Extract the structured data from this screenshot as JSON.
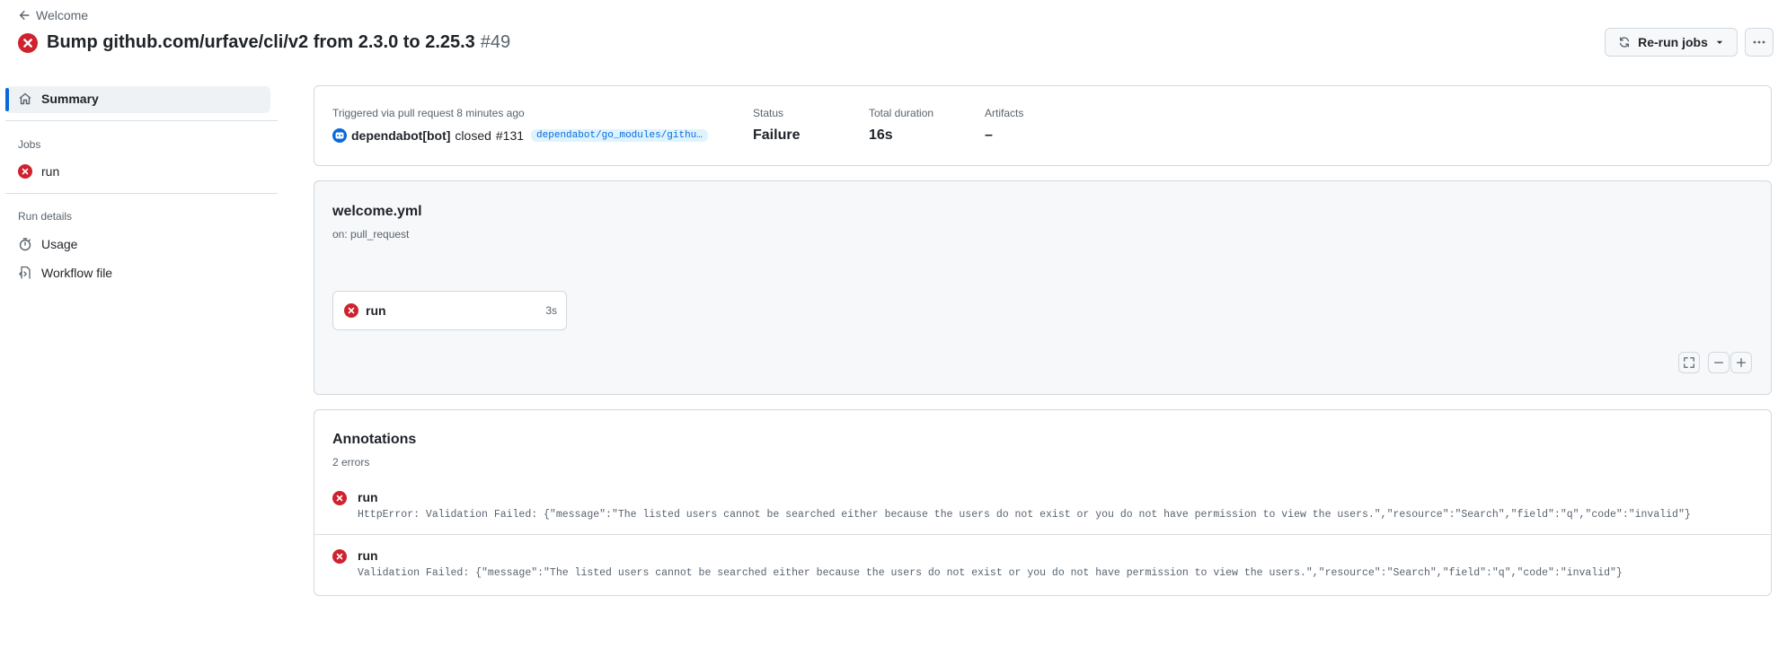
{
  "header": {
    "back_label": "Welcome",
    "title": "Bump github.com/urfave/cli/v2 from 2.3.0 to 2.25.3",
    "run_number": "#49",
    "rerun_label": "Re-run jobs"
  },
  "sidebar": {
    "summary_label": "Summary",
    "jobs_heading": "Jobs",
    "job_label": "run",
    "run_details_heading": "Run details",
    "usage_label": "Usage",
    "workflow_file_label": "Workflow file"
  },
  "summary": {
    "trigger_text": "Triggered via pull request 8 minutes ago",
    "actor": "dependabot[bot]",
    "action": "closed",
    "pr_number": "#131",
    "branch": "dependabot/go_modules/githu…",
    "status_label": "Status",
    "status_value": "Failure",
    "duration_label": "Total duration",
    "duration_value": "16s",
    "artifacts_label": "Artifacts",
    "artifacts_value": "–"
  },
  "workflow": {
    "file": "welcome.yml",
    "trigger": "on: pull_request",
    "job_name": "run",
    "job_duration": "3s"
  },
  "annotations": {
    "title": "Annotations",
    "count_text": "2 errors",
    "items": [
      {
        "job": "run",
        "message": "HttpError: Validation Failed: {\"message\":\"The listed users cannot be searched either because the users do not exist or you do not have permission to view the users.\",\"resource\":\"Search\",\"field\":\"q\",\"code\":\"invalid\"}"
      },
      {
        "job": "run",
        "message": "Validation Failed: {\"message\":\"The listed users cannot be searched either because the users do not exist or you do not have permission to view the users.\",\"resource\":\"Search\",\"field\":\"q\",\"code\":\"invalid\"}"
      }
    ]
  },
  "colors": {
    "error": "#cf222e",
    "accent": "#0969da",
    "muted": "#59636e",
    "border": "#d1d9e0"
  }
}
